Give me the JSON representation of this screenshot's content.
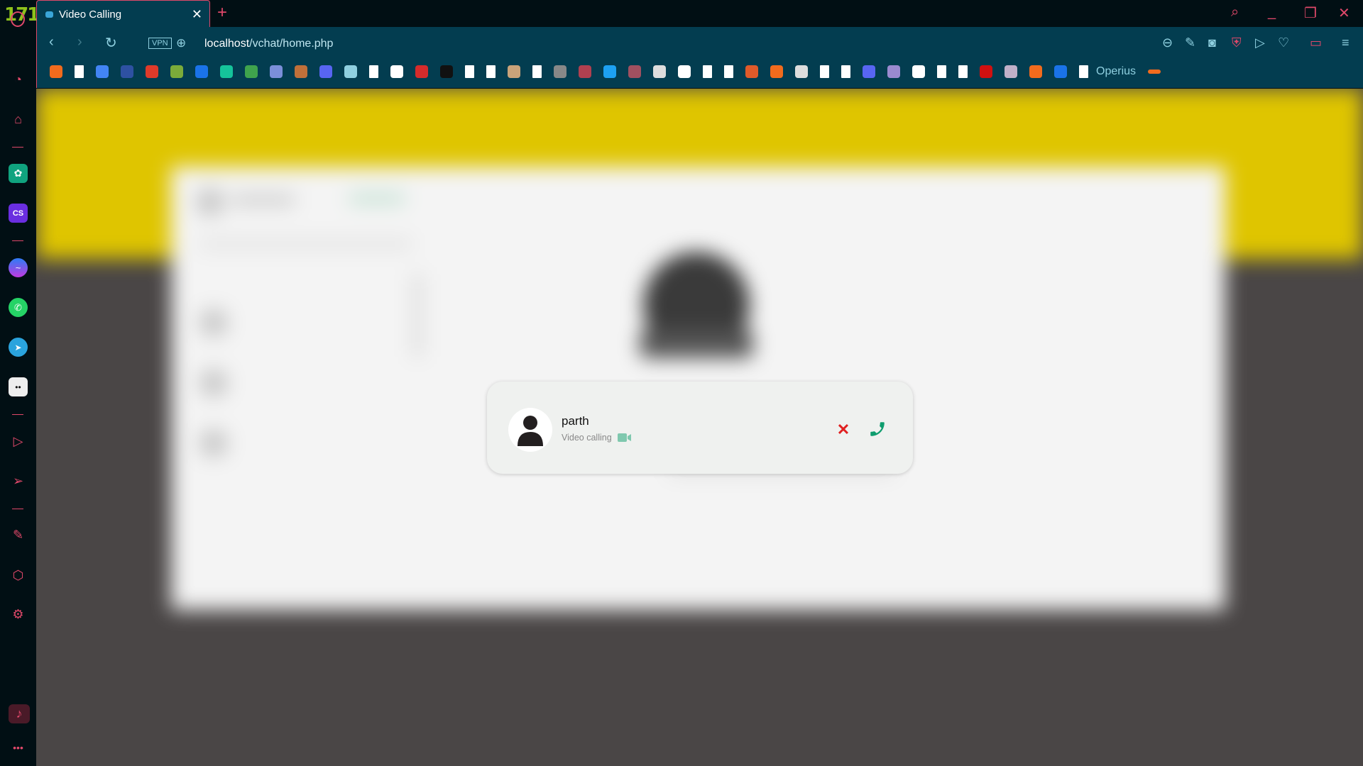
{
  "browser": {
    "logo": "171",
    "tab": {
      "title": "Video Calling"
    },
    "url": {
      "host": "localhost",
      "path": "/vchat/home.php"
    },
    "vpn_label": "VPN",
    "accent": "#e0486a",
    "bookmarks": [
      {
        "icon": "swoosh-icon",
        "color": "#f26b1d"
      },
      {
        "icon": "page-icon",
        "color": "#ffffff"
      },
      {
        "icon": "lens-icon",
        "color": "#4285f4"
      },
      {
        "icon": "mal-icon",
        "color": "#2e51a2"
      },
      {
        "icon": "fox-icon",
        "color": "#e03a2a"
      },
      {
        "icon": "chess-icon",
        "color": "#7bab3a"
      },
      {
        "icon": "z-icon",
        "color": "#1a73e8"
      },
      {
        "icon": "grammarly-icon",
        "color": "#15c39a"
      },
      {
        "icon": "robot-icon",
        "color": "#3fa34d"
      },
      {
        "icon": "search-icon",
        "color": "#7b8fd9"
      },
      {
        "icon": "box-icon",
        "color": "#c0703a"
      },
      {
        "icon": "discord-icon",
        "color": "#5865f2"
      },
      {
        "icon": "folder-icon",
        "color": "#8fd0e0"
      },
      {
        "icon": "page-icon",
        "color": "#ffffff"
      },
      {
        "icon": "codepen-icon",
        "color": "#ffffff"
      },
      {
        "icon": "flame-icon",
        "color": "#d62b2b"
      },
      {
        "icon": "dark-icon",
        "color": "#111111"
      },
      {
        "icon": "page-icon",
        "color": "#ffffff"
      },
      {
        "icon": "page-icon",
        "color": "#ffffff"
      },
      {
        "icon": "image-icon",
        "color": "#c9a37a"
      },
      {
        "icon": "page-icon",
        "color": "#ffffff"
      },
      {
        "icon": "image-icon",
        "color": "#888888"
      },
      {
        "icon": "image-icon",
        "color": "#b04050"
      },
      {
        "icon": "x-icon",
        "color": "#1da1f2"
      },
      {
        "icon": "image-icon",
        "color": "#a05060"
      },
      {
        "icon": "book-icon",
        "color": "#dddddd"
      },
      {
        "icon": "torch-icon",
        "color": "#ffffff"
      },
      {
        "icon": "page-icon",
        "color": "#ffffff"
      },
      {
        "icon": "page-icon",
        "color": "#ffffff"
      },
      {
        "icon": "bar-icon",
        "color": "#e05a2a"
      },
      {
        "icon": "p-icon",
        "color": "#f26b1d"
      },
      {
        "icon": "store-icon",
        "color": "#dddddd"
      },
      {
        "icon": "page-icon",
        "color": "#ffffff"
      },
      {
        "icon": "page-icon",
        "color": "#ffffff"
      },
      {
        "icon": "discord-icon",
        "color": "#5865f2"
      },
      {
        "icon": "dragon-icon",
        "color": "#9a8ad0"
      },
      {
        "icon": "github-icon",
        "color": "#ffffff"
      },
      {
        "icon": "page-icon",
        "color": "#ffffff"
      },
      {
        "icon": "page-icon",
        "color": "#ffffff"
      },
      {
        "icon": "robot-icon",
        "color": "#d01010"
      },
      {
        "icon": "anime-icon",
        "color": "#c0b0c8"
      },
      {
        "icon": "au-icon",
        "color": "#f26b1d"
      },
      {
        "icon": "s-icon",
        "color": "#1a73e8"
      },
      {
        "icon": "page-icon",
        "color": "#ffffff"
      }
    ],
    "bookmark_label": "Operius"
  },
  "call": {
    "caller_name": "parth",
    "status": "Video calling",
    "accept_color": "#0f9d6e",
    "decline_color": "#e02020"
  }
}
